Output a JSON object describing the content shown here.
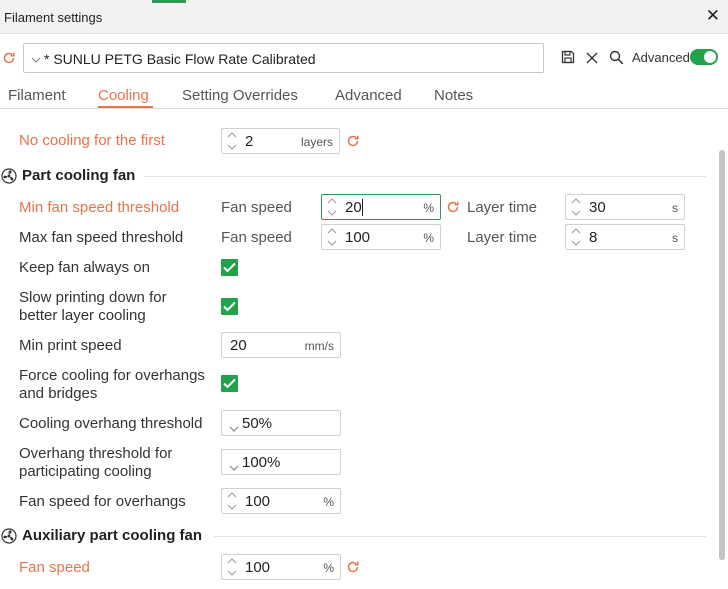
{
  "window": {
    "title": "Filament settings"
  },
  "preset": {
    "name": "* SUNLU PETG Basic Flow Rate Calibrated",
    "advanced_label": "Advanced",
    "advanced_on": true
  },
  "tabs": [
    {
      "label": "Filament",
      "active": false
    },
    {
      "label": "Cooling",
      "active": true
    },
    {
      "label": "Setting Overrides",
      "active": false
    },
    {
      "label": "Advanced",
      "active": false
    },
    {
      "label": "Notes",
      "active": false
    }
  ],
  "no_cooling": {
    "label": "No cooling for the first",
    "value": "2",
    "unit": "layers"
  },
  "part_cooling": {
    "title": "Part cooling fan",
    "min_fan": {
      "label": "Min fan speed threshold",
      "fan_label": "Fan speed",
      "fan_value": "20",
      "fan_unit": "%",
      "layer_label": "Layer time",
      "layer_value": "30",
      "layer_unit": "s"
    },
    "max_fan": {
      "label": "Max fan speed threshold",
      "fan_label": "Fan speed",
      "fan_value": "100",
      "fan_unit": "%",
      "layer_label": "Layer time",
      "layer_value": "8",
      "layer_unit": "s"
    },
    "keep_fan": {
      "label": "Keep fan always on",
      "checked": true
    },
    "slow_down": {
      "label_line1": "Slow printing down for",
      "label_line2": "better layer cooling",
      "checked": true
    },
    "min_print_speed": {
      "label": "Min print speed",
      "value": "20",
      "unit": "mm/s"
    },
    "force_cooling": {
      "label_line1": "Force cooling for overhangs",
      "label_line2": "and bridges",
      "checked": true
    },
    "overhang_threshold": {
      "label": "Cooling overhang threshold",
      "value": "50%"
    },
    "participating": {
      "label_line1": "Overhang threshold for",
      "label_line2": "participating cooling",
      "value": "100%"
    },
    "overhang_fan": {
      "label": "Fan speed for overhangs",
      "value": "100",
      "unit": "%"
    }
  },
  "aux_fan": {
    "title": "Auxiliary part cooling fan",
    "label": "Fan speed",
    "value": "100",
    "unit": "%"
  },
  "colors": {
    "accent": "#e8734b",
    "check": "#22a24a",
    "focus": "#2e9a55"
  },
  "icons": [
    "reset-icon",
    "save-icon",
    "delete-icon",
    "search-icon",
    "fan-icon",
    "check-icon",
    "spin-icon",
    "chevron-down-icon",
    "close-icon"
  ]
}
